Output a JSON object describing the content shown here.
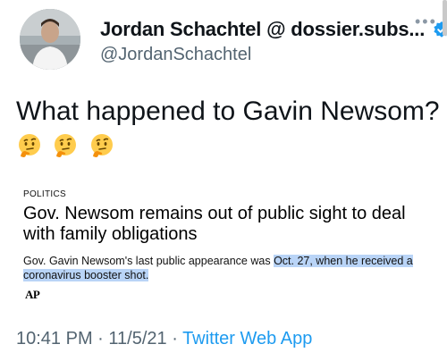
{
  "author": {
    "display_name": "Jordan Schachtel @ dossier.subs...",
    "handle": "@JordanSchachtel",
    "verified": true
  },
  "tweet": {
    "text": "What happened to Gavin Newsom?",
    "emojis": [
      "thinking-face",
      "thinking-face",
      "thinking-face"
    ]
  },
  "card": {
    "section": "POLITICS",
    "headline": "Gov. Newsom remains out of public sight to deal with family obligations",
    "summary_plain": "Gov. Gavin Newsom's last public appearance was ",
    "summary_highlight": "Oct. 27, when he received a coronavirus booster shot.",
    "logo_text": "AP"
  },
  "meta": {
    "time": "10:41 PM",
    "separator": " · ",
    "date": "11/5/21",
    "source": "Twitter Web App"
  },
  "colors": {
    "accent": "#1d9bf0",
    "secondary_text": "#536471",
    "highlight": "#b9d4f7"
  }
}
